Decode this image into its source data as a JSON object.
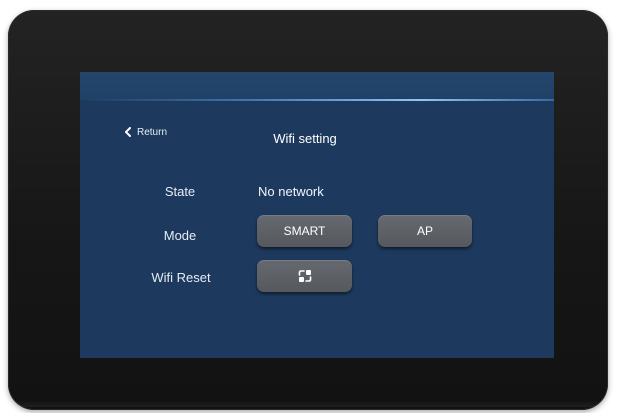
{
  "header": {
    "return_label": "Return",
    "title": "Wifi setting"
  },
  "state": {
    "label": "State",
    "value": "No network"
  },
  "mode": {
    "label": "Mode",
    "options": [
      "SMART",
      "AP"
    ]
  },
  "wifi_reset": {
    "label": "Wifi Reset",
    "icon": "reset-icon"
  },
  "colors": {
    "screen_bg": "#1d3a5e",
    "button_bg": "#5f6368",
    "bezel": "#1a1a1a"
  }
}
